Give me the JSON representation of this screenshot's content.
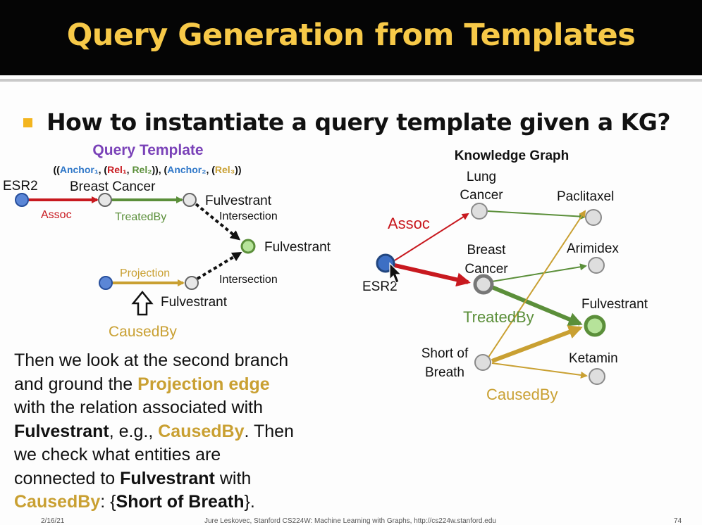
{
  "slide": {
    "title": "Query Generation from Templates",
    "headline": "How to instantiate a query template given a KG?"
  },
  "colors": {
    "title": "#f7c948",
    "anchor_blue": "#2f77c8",
    "relation_red": "#c8191f",
    "relation_green": "#5b8f3a",
    "relation_gold": "#c9a032",
    "purple": "#7a42b8"
  },
  "template": {
    "heading": "Query Template",
    "formula_parts": [
      "((",
      "Anchor₁",
      ", (",
      "Rel₁",
      ", ",
      "Rel₂",
      ")), (",
      "Anchor₂",
      ", (",
      "Rel₃",
      "))"
    ],
    "labels": {
      "esr2": "ESR2",
      "breast_cancer": "Breast Cancer",
      "fulvestrant_top": "Fulvestrant",
      "intersection_top": "Intersection",
      "fulvestrant_target": "Fulvestrant",
      "intersection_bottom": "Intersection",
      "fulvestrant_bottom": "Fulvestrant",
      "assoc": "Assoc",
      "treated_by": "TreatedBy",
      "projection": "Projection",
      "caused_by": "CausedBy"
    }
  },
  "kg": {
    "heading": "Knowledge Graph",
    "nodes": {
      "esr2": "ESR2",
      "lung_cancer_1": "Lung",
      "lung_cancer_2": "Cancer",
      "breast_cancer_1": "Breast",
      "breast_cancer_2": "Cancer",
      "short_breath_1": "Short of",
      "short_breath_2": "Breath",
      "paclitaxel": "Paclitaxel",
      "arimidex": "Arimidex",
      "fulvestrant": "Fulvestrant",
      "ketamin": "Ketamin"
    },
    "relations": {
      "assoc": "Assoc",
      "treated_by": "TreatedBy",
      "caused_by": "CausedBy"
    }
  },
  "paragraph": {
    "l1": "Then we look at the second branch",
    "l2a": "and ground the ",
    "l2b": "Projection edge",
    "l3": "with the relation associated with",
    "l4a": "Fulvestrant",
    "l4b": ", e.g., ",
    "l4c": "CausedBy",
    "l4d": ". Then",
    "l5": "we check what entities are",
    "l6a": "connected to ",
    "l6b": "Fulvestrant",
    "l6c": " with",
    "l7a": "CausedBy",
    "l7b": ": {",
    "l7c": "Short of Breath",
    "l7d": "}."
  },
  "footer": {
    "date": "2/16/21",
    "credit": "Jure Leskovec, Stanford CS224W: Machine Learning with Graphs, http://cs224w.stanford.edu",
    "page": "74"
  }
}
